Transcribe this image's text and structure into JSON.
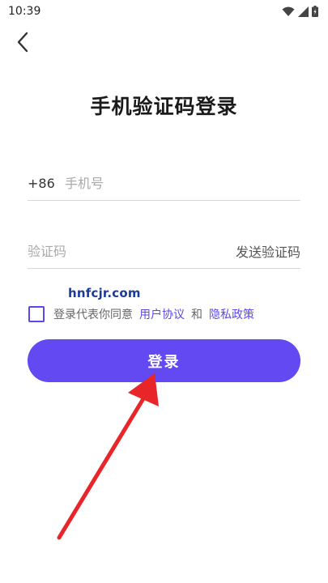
{
  "status_bar": {
    "time": "10:39"
  },
  "title": "手机验证码登录",
  "phone": {
    "country_code": "+86",
    "placeholder": "手机号",
    "value": ""
  },
  "code": {
    "placeholder": "验证码",
    "value": "",
    "send_label": "发送验证码"
  },
  "watermark": "hnfcjr.com",
  "agreement": {
    "prefix": "登录代表你同意",
    "user_agreement": "用户协议",
    "and": "和",
    "privacy_policy": "隐私政策",
    "checked": false
  },
  "login_button": "登录",
  "colors": {
    "accent": "#6249f2",
    "link": "#5a49e8",
    "annotation_arrow": "#e8262a"
  },
  "icons": [
    "back-arrow-icon",
    "wifi-icon",
    "signal-icon",
    "battery-icon"
  ]
}
